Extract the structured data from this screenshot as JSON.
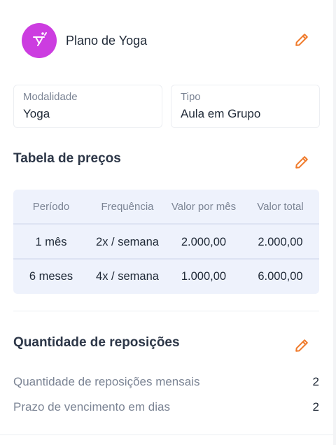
{
  "header": {
    "title": "Plano de Yoga",
    "avatar_icon": "yoga-pose-icon",
    "avatar_color": "#cc3de0"
  },
  "accent_color": "#f07b2c",
  "fields": {
    "modalidade": {
      "label": "Modalidade",
      "value": "Yoga"
    },
    "tipo": {
      "label": "Tipo",
      "value": "Aula em Grupo"
    }
  },
  "prices": {
    "title": "Tabela de preços",
    "columns": [
      "Período",
      "Frequência",
      "Valor por mês",
      "Valor total"
    ],
    "rows": [
      [
        "1 mês",
        "2x / semana",
        "2.000,00",
        "2.000,00"
      ],
      [
        "6 meses",
        "4x / semana",
        "1.000,00",
        "6.000,00"
      ]
    ]
  },
  "replacements": {
    "title": "Quantidade de reposições",
    "items": [
      {
        "label": "Quantidade de reposições mensais",
        "value": "2"
      },
      {
        "label": "Prazo de vencimento em dias",
        "value": "2"
      }
    ]
  }
}
